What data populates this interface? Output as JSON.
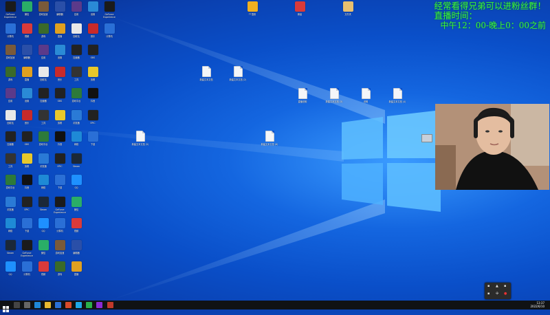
{
  "overlay": {
    "line1": "经常看得兄弟可以进粉丝群！",
    "line2": "直播时间：",
    "line3": "中午12：00-晚上0：00之前"
  },
  "taskbar": {
    "time": "13:37",
    "date": "2022/6/10"
  },
  "colors": {
    "overlay_text": "#3df03d",
    "desktop_blue": "#0a4fc9",
    "taskbar": "#101214"
  },
  "icons": [
    {
      "name": "icon-0",
      "label": "GeForce Experience",
      "glyph": "gear-icon",
      "color": "#1b1b1b"
    },
    {
      "name": "icon-1",
      "label": "计算机",
      "glyph": "computer-icon",
      "color": "#2a6fd6"
    },
    {
      "name": "icon-2",
      "label": "游戏加速",
      "glyph": "game-icon",
      "color": "#7a5a3a"
    },
    {
      "name": "icon-3",
      "label": "游戏",
      "glyph": "game-icon",
      "color": "#3a6a2a"
    },
    {
      "name": "icon-4",
      "label": "应用",
      "glyph": "app-icon",
      "color": "#5b3a8a"
    },
    {
      "name": "icon-5",
      "label": "回收站",
      "glyph": "doc-icon",
      "color": "#e8e8e8"
    },
    {
      "name": "icon-6",
      "label": "加速器",
      "glyph": "app-icon",
      "color": "#222"
    },
    {
      "name": "icon-7",
      "label": "工具",
      "glyph": "app-icon",
      "color": "#333"
    },
    {
      "name": "icon-8",
      "label": "游戏平台",
      "glyph": "game-icon",
      "color": "#2d7a3a"
    },
    {
      "name": "icon-9",
      "label": "浏览器",
      "glyph": "globe-icon",
      "color": "#2a7ad6"
    },
    {
      "name": "icon-10",
      "label": "网络",
      "glyph": "globe-icon",
      "color": "#1e8ad6"
    },
    {
      "name": "icon-11",
      "label": "Steam",
      "glyph": "steam-icon",
      "color": "#1b2838"
    },
    {
      "name": "icon-12",
      "label": "QQ",
      "glyph": "qq-icon",
      "color": "#1e90ff"
    },
    {
      "name": "icon-13",
      "label": "微信",
      "glyph": "chat-icon",
      "color": "#2aae67"
    },
    {
      "name": "icon-14",
      "label": "视频",
      "glyph": "video-icon",
      "color": "#d93a3a"
    },
    {
      "name": "icon-15",
      "label": "编辑器",
      "glyph": "app-icon",
      "color": "#2a4fa8"
    },
    {
      "name": "icon-16",
      "label": "直播",
      "glyph": "video-icon",
      "color": "#e0a020"
    },
    {
      "name": "icon-17",
      "label": "设置",
      "glyph": "gear-icon",
      "color": "#2a8ad6"
    },
    {
      "name": "icon-18",
      "label": "音乐",
      "glyph": "music-icon",
      "color": "#c82a2a"
    },
    {
      "name": "icon-19",
      "label": "OBS",
      "glyph": "record-icon",
      "color": "#222"
    },
    {
      "name": "icon-20",
      "label": "剪辑",
      "glyph": "app-icon",
      "color": "#e8c82a"
    },
    {
      "name": "icon-21",
      "label": "抖音",
      "glyph": "music-icon",
      "color": "#111"
    },
    {
      "name": "icon-22",
      "label": "EPIC",
      "glyph": "game-icon",
      "color": "#222"
    },
    {
      "name": "icon-23",
      "label": "下载",
      "glyph": "download-icon",
      "color": "#2a6fd6"
    }
  ],
  "files": [
    {
      "name": "file-1",
      "label": "新建文本文档"
    },
    {
      "name": "file-2",
      "label": "新建文本文档 (2)"
    },
    {
      "name": "file-3",
      "label": "直播说明"
    },
    {
      "name": "file-4",
      "label": "新建文本文档 (3)"
    },
    {
      "name": "file-5",
      "label": "说明"
    },
    {
      "name": "file-6",
      "label": "新建文本文档 (4)"
    },
    {
      "name": "file-7",
      "label": "新建文本文档 (5)"
    },
    {
      "name": "file-8",
      "label": "新建文本文档 (6)"
    }
  ],
  "top_icons": [
    {
      "name": "top-icon-1",
      "label": "TT语音",
      "color": "#f0b020"
    },
    {
      "name": "top-icon-2",
      "label": "新建",
      "color": "#d83a3a"
    },
    {
      "name": "top-icon-3",
      "label": "文件夹",
      "color": "#e8c070"
    }
  ]
}
